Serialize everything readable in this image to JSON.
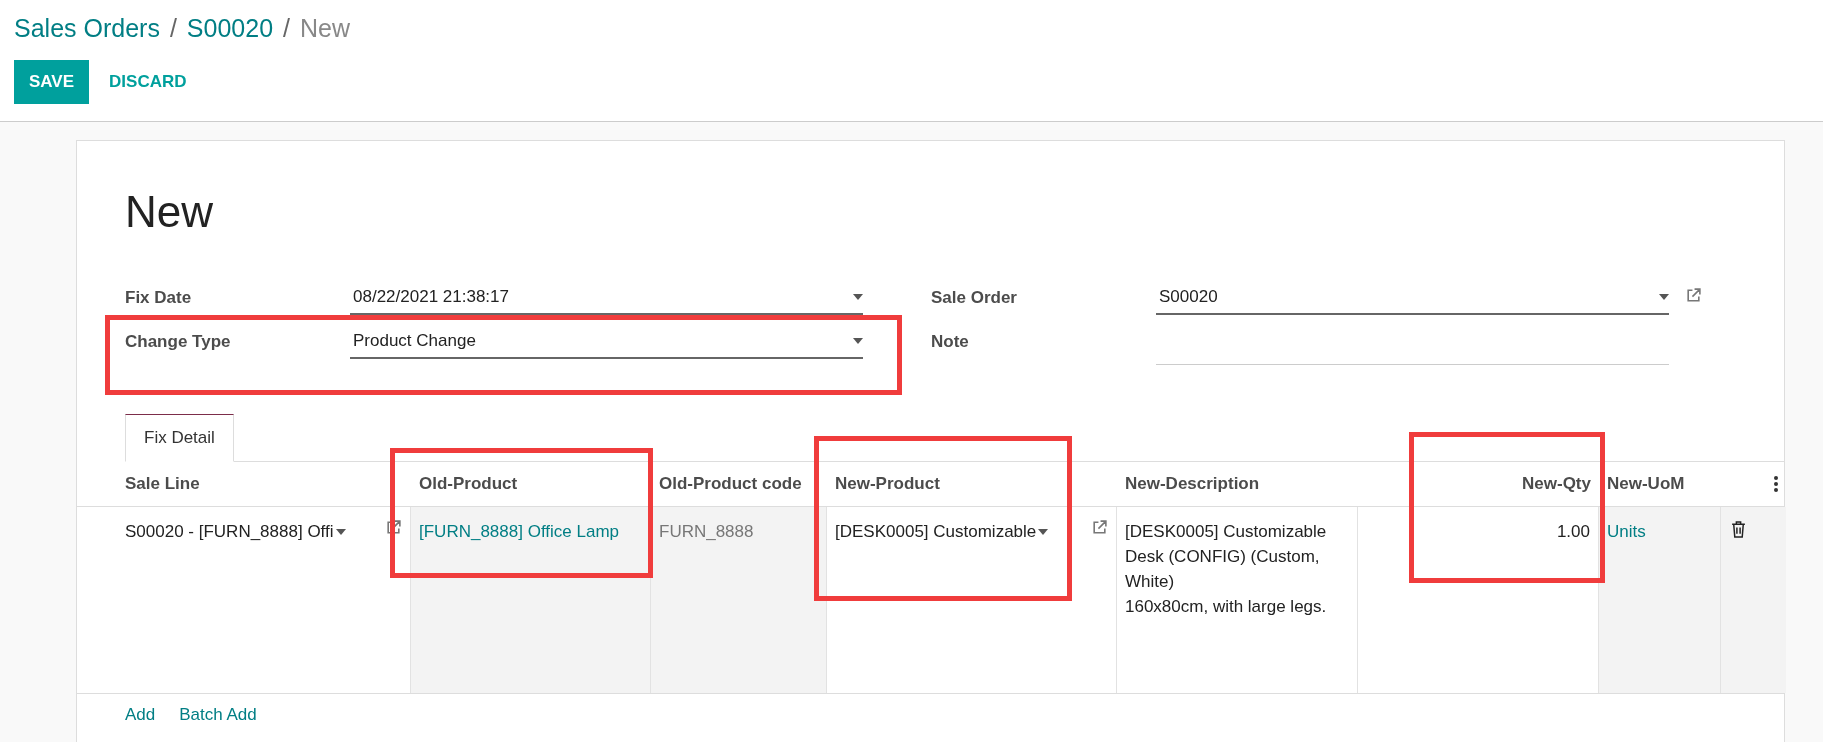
{
  "breadcrumb": [
    {
      "label": "Sales Orders",
      "kind": "link"
    },
    {
      "label": "/",
      "kind": "separator"
    },
    {
      "label": "S00020",
      "kind": "link"
    },
    {
      "label": "/",
      "kind": "separator"
    },
    {
      "label": "New",
      "kind": "current"
    }
  ],
  "buttons": [
    {
      "label": "SAVE",
      "kind": "primary"
    },
    {
      "label": "DISCARD",
      "kind": "link"
    }
  ],
  "title": "New",
  "fields_left": [
    {
      "label": "Fix Date",
      "value": "08/22/2021 21:38:17",
      "kind": "dropdown",
      "external_link": false
    },
    {
      "label": "Change Type",
      "value": "Product Change",
      "kind": "dropdown",
      "external_link": false
    }
  ],
  "fields_right": [
    {
      "label": "Sale Order",
      "value": "S00020",
      "kind": "dropdown",
      "external_link": true
    },
    {
      "label": "Note",
      "kind": "text",
      "external_link": false
    }
  ],
  "tabs": [
    {
      "label": "Fix Detail",
      "selected": true
    }
  ],
  "table": {
    "columns": [
      {
        "label": "Sale Line",
        "kind": "text"
      },
      {
        "label": "Old-Product",
        "kind": "text"
      },
      {
        "label": "Old-Product code",
        "kind": "text"
      },
      {
        "label": "New-Product",
        "kind": "text"
      },
      {
        "label": "New-Description",
        "kind": "text"
      },
      {
        "label": "New-Qty",
        "kind": "number"
      },
      {
        "label": "New-UoM",
        "kind": "text"
      }
    ],
    "rows": [
      {
        "cells": [
          {
            "kind": "dropdown",
            "text": "S00020 - [FURN_8888] Offi",
            "readonly": false,
            "external_link": true
          },
          {
            "kind": "link",
            "text": "[FURN_8888] Office Lamp",
            "readonly": true
          },
          {
            "kind": "plain",
            "text": "FURN_8888",
            "readonly": true
          },
          {
            "kind": "dropdown",
            "text": "[DESK0005] Customizable",
            "readonly": false,
            "external_link": true
          },
          {
            "kind": "multiline",
            "text": "[DESK0005] Customizable Desk (CONFIG) (Custom, White)\n160x80cm, with large legs.",
            "readonly": false
          },
          {
            "kind": "number",
            "text": "1.00",
            "readonly": false
          },
          {
            "kind": "link",
            "text": "Units",
            "readonly": true
          }
        ],
        "deletable": true
      }
    ]
  },
  "footer_links": [
    "Add",
    "Batch Add"
  ]
}
